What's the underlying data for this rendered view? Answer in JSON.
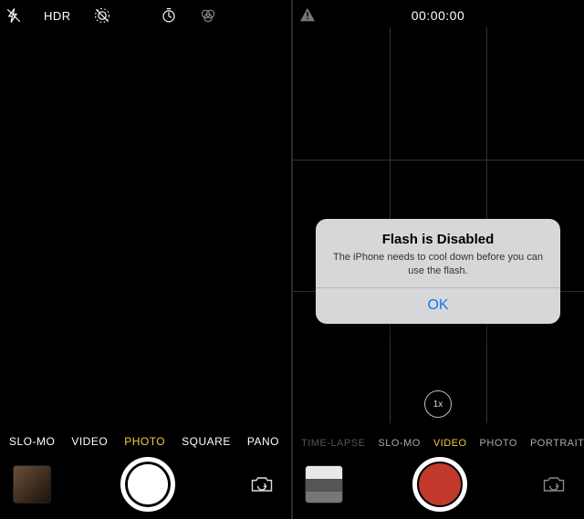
{
  "left": {
    "topbar": {
      "hdr": "HDR"
    },
    "modes": [
      "SLO-MO",
      "VIDEO",
      "PHOTO",
      "SQUARE",
      "PANO"
    ],
    "selected_mode_index": 2
  },
  "right": {
    "recording_time": "00:00:00",
    "zoom_label": "1x",
    "modes": [
      "TIME-LAPSE",
      "SLO-MO",
      "VIDEO",
      "PHOTO",
      "PORTRAIT"
    ],
    "selected_mode_index": 2,
    "dim_mode_index": 0,
    "alert": {
      "title": "Flash is Disabled",
      "message": "The iPhone needs to cool down before you can use the flash.",
      "ok": "OK"
    }
  }
}
